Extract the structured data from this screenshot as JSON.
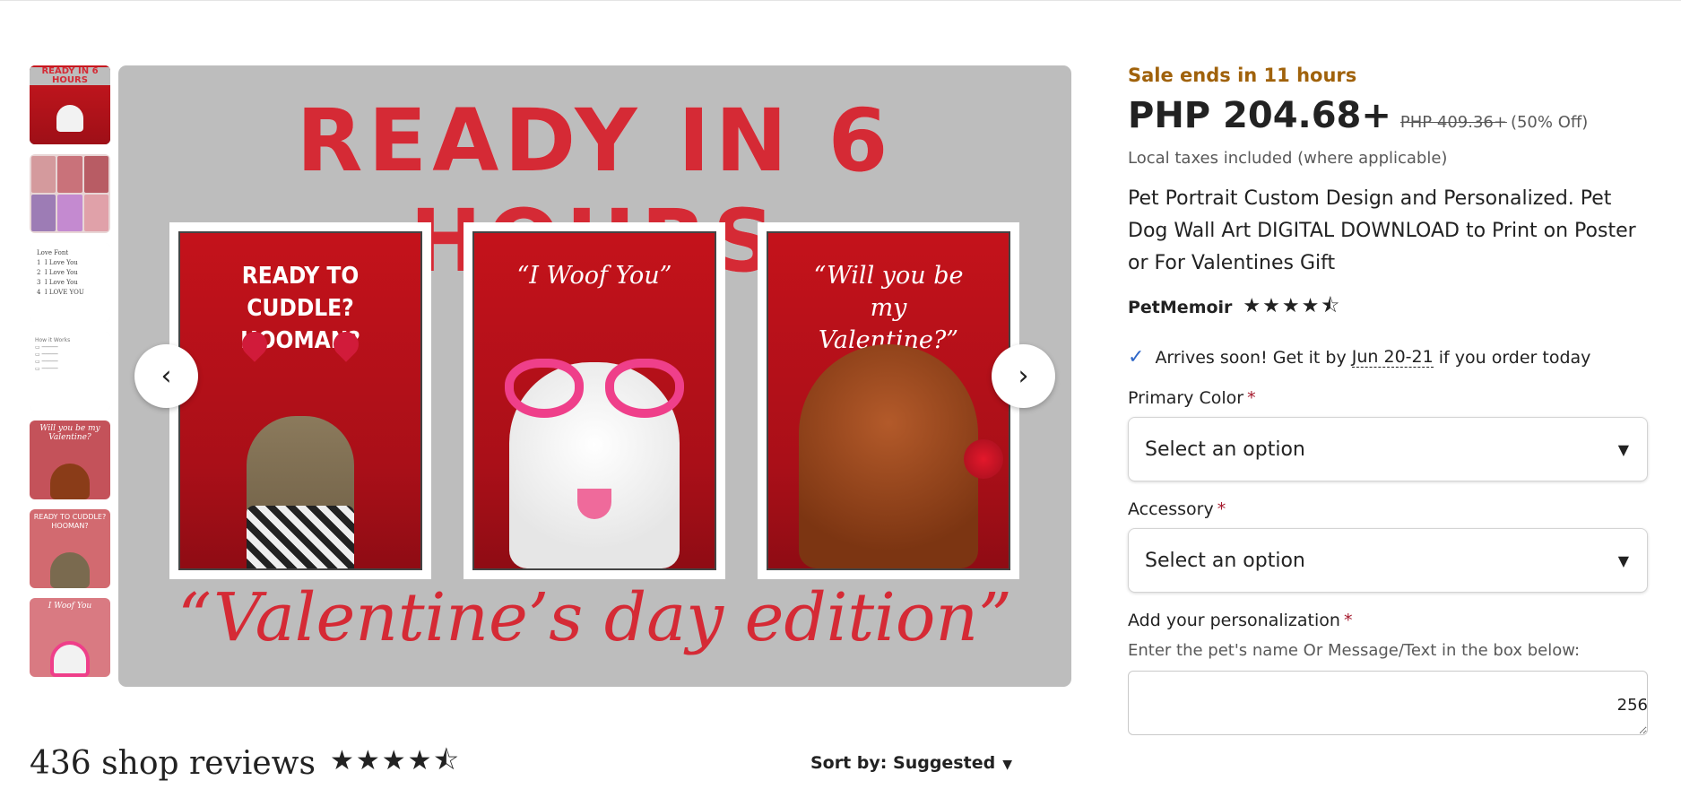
{
  "listing": {
    "sale_notice": "Sale ends in 11 hours",
    "price": "PHP 204.68+",
    "original_price": "PHP 409.36+",
    "discount": "(50% Off)",
    "taxes_note": "Local taxes included (where applicable)",
    "title": "Pet Portrait Custom Design and Personalized. Pet Dog Wall Art DIGITAL DOWNLOAD to Print on Poster or For Valentines Gift",
    "shop_name": "PetMemoir",
    "shop_rating_stars": "★★★★⯪",
    "shop_rating": 4.5,
    "arrives_prefix": "Arrives soon! Get it by",
    "arrives_date": "Jun 20-21",
    "arrives_suffix": "if you order today"
  },
  "options": {
    "primary_color_label": "Primary Color",
    "primary_color_value": "Select an option",
    "accessory_label": "Accessory",
    "accessory_value": "Select an option",
    "personalization_label": "Add your personalization",
    "personalization_hint": "Enter the pet's name Or Message/Text in the box below:",
    "personalization_value": "",
    "char_remaining": "256",
    "required_mark": "*"
  },
  "gallery": {
    "headline": "READY IN 6 HOURS",
    "subline": "“Valentine’s day edition”",
    "card1_caption": "READY TO CUDDLE? HOOMAN?",
    "card2_caption": "“I Woof You”",
    "card3_caption": "“Will you be my Valentine?”",
    "prev_icon": "‹",
    "next_icon": "›",
    "thumb_count": 7,
    "active_thumb": 1
  },
  "reviews": {
    "count_text": "436 shop reviews",
    "stars": "★★★★⯪",
    "rating": 4.5,
    "sort_label": "Sort by: Suggested",
    "sort_caret": "▼"
  },
  "icons": {
    "check": "✓",
    "select_caret": "▼"
  },
  "colors": {
    "sale": "#a0620b",
    "accent_red": "#d52a35",
    "check_blue": "#2f67c8",
    "required": "#a61a2e"
  }
}
